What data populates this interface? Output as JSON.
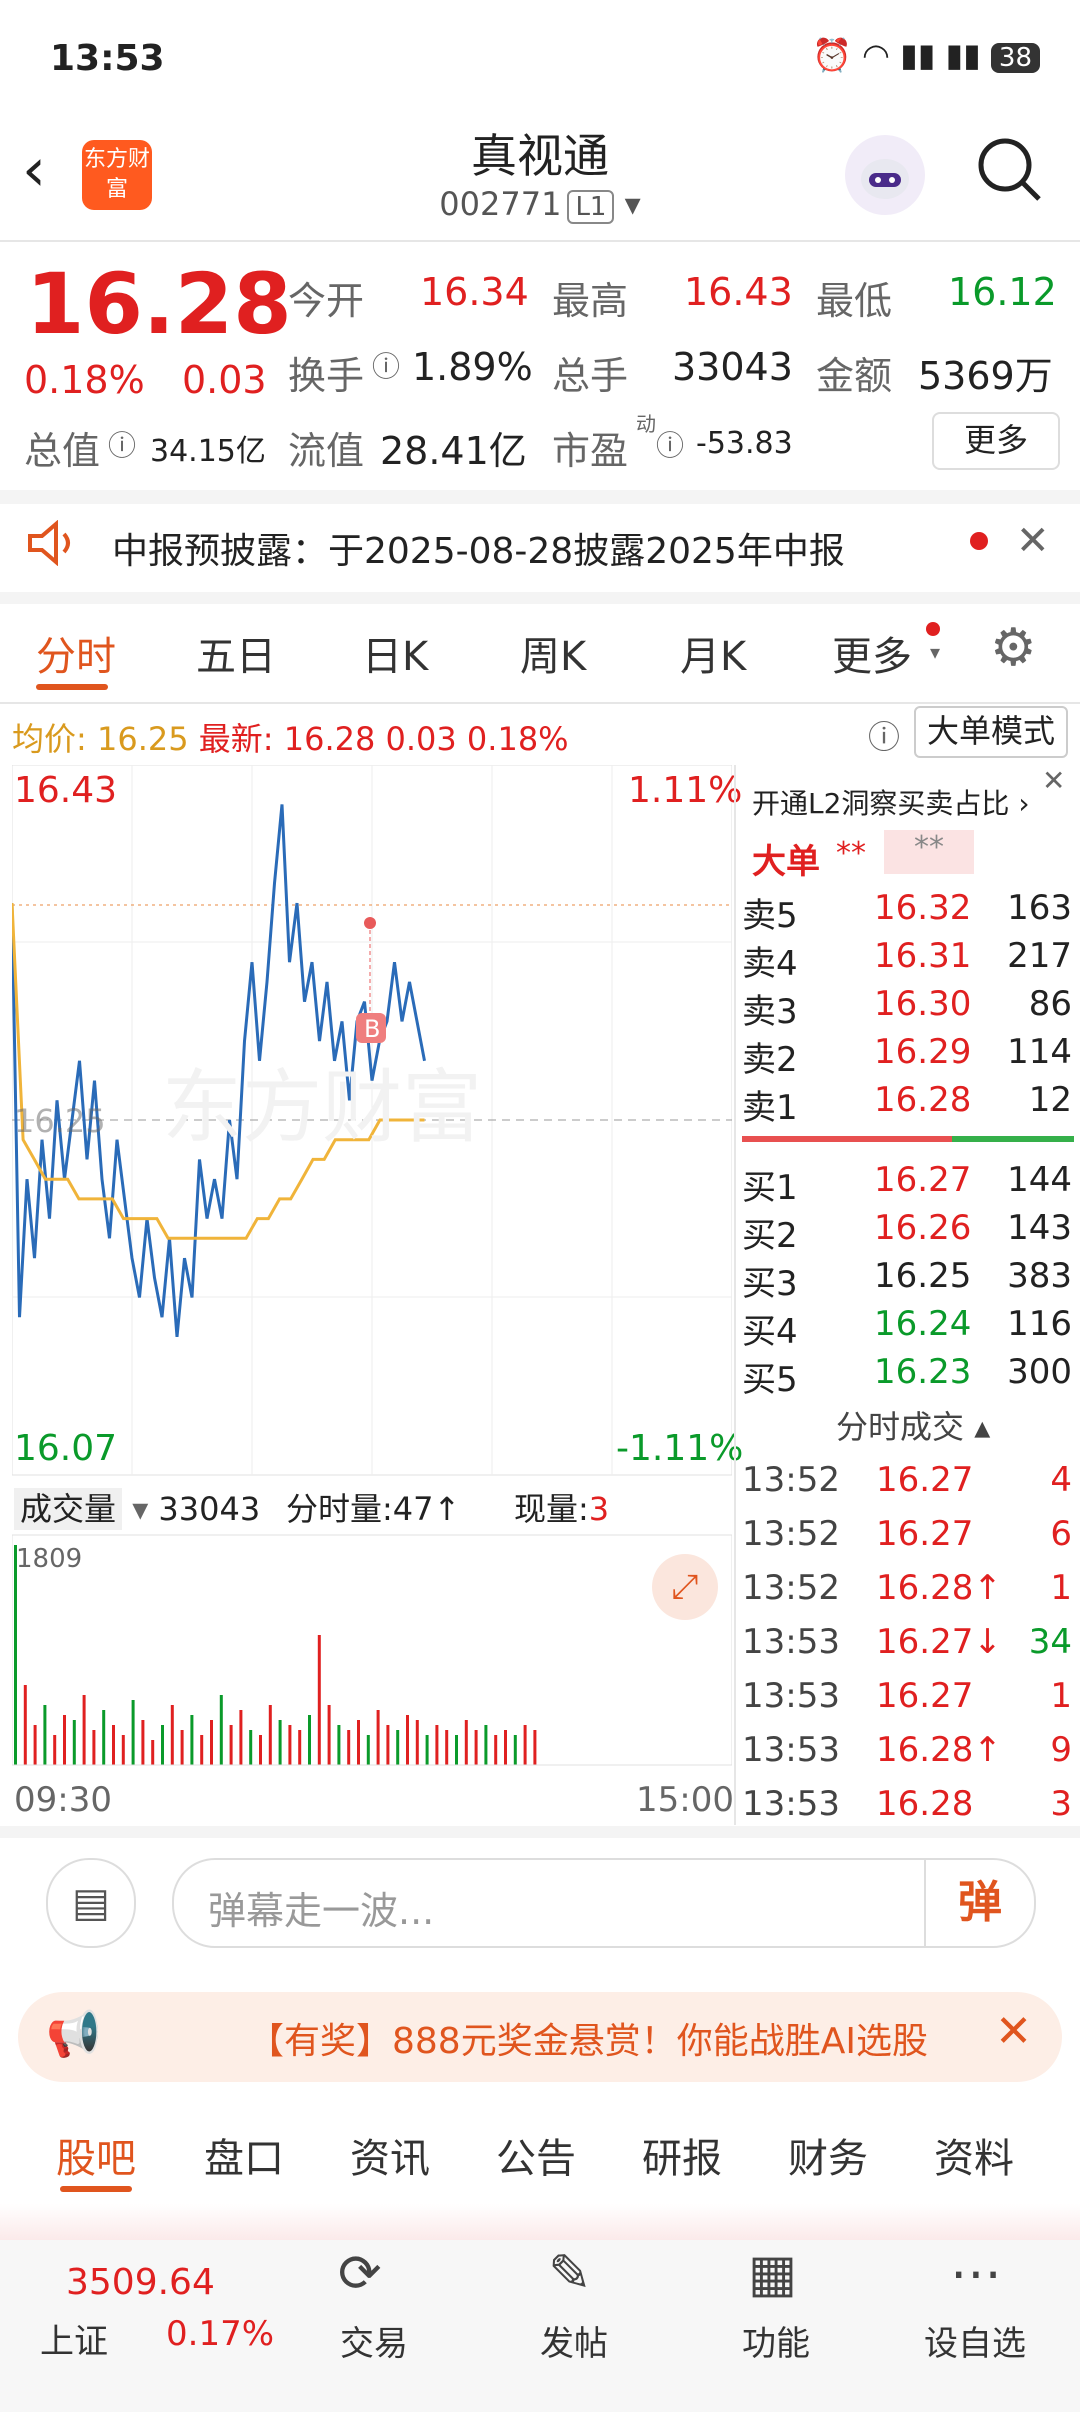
{
  "status": {
    "time": "13:53",
    "battery": "38"
  },
  "header": {
    "title": "真视通",
    "code": "002771",
    "level": "L1",
    "logo_text": "东方财富"
  },
  "quote": {
    "price": "16.28",
    "change_pct": "0.18%",
    "change": "0.03",
    "open_label": "今开",
    "open": "16.34",
    "high_label": "最高",
    "high": "16.43",
    "low_label": "最低",
    "low": "16.12",
    "turnover_label": "换手",
    "turnover": "1.89%",
    "volume_label": "总手",
    "volume": "33043",
    "amount_label": "金额",
    "amount": "5369万",
    "mktcap_label": "总值",
    "mktcap": "34.15亿",
    "float_label": "流值",
    "float_cap": "28.41亿",
    "pe_label": "市盈",
    "pe_sup": "动",
    "pe": "-53.83",
    "more": "更多"
  },
  "notice": {
    "text": "中报预披露：于2025-08-28披露2025年中报"
  },
  "tabs": [
    "分时",
    "五日",
    "日K",
    "周K",
    "月K",
    "更多"
  ],
  "avg_line": {
    "avg_label": "均价:",
    "avg": "16.25",
    "latest_label": "最新:",
    "latest": "16.28",
    "chg": "0.03",
    "pct": "0.18%",
    "mode": "大单模式"
  },
  "chart": {
    "max_price": "16.43",
    "max_pct": "1.11%",
    "min_price": "16.07",
    "min_pct": "-1.11%",
    "prev_close": "16.25",
    "start_time": "09:30",
    "end_time": "15:00",
    "vol_label": "成交量",
    "vol_total": "33043",
    "minute_vol": "分时量:47↑",
    "now_vol_label": "现量:",
    "now_vol": "3",
    "vol_max": "1809",
    "watermark": "东方财富",
    "b_marker": "B"
  },
  "chart_data": {
    "type": "line",
    "x": [
      "09:30",
      "15:00"
    ],
    "ylim": [
      16.07,
      16.43
    ],
    "series": [
      {
        "values": [
          16.36,
          16.15,
          16.22,
          16.18,
          16.24,
          16.2,
          16.26,
          16.22,
          16.25,
          16.28,
          16.23,
          16.27,
          16.22,
          16.19,
          16.24,
          16.21,
          16.18,
          16.16,
          16.2,
          16.17,
          16.15,
          16.19,
          16.14,
          16.18,
          16.16,
          16.23,
          16.2,
          16.22,
          16.2,
          16.25,
          16.22,
          16.29,
          16.33,
          16.28,
          16.32,
          16.37,
          16.41,
          16.33,
          16.36,
          16.31,
          16.33,
          16.29,
          16.32,
          16.28,
          16.3,
          16.26,
          16.3,
          16.31,
          16.27,
          16.29,
          16.3,
          16.33,
          16.3,
          16.32,
          16.3,
          16.28
        ]
      },
      {
        "values": [
          16.36,
          16.24,
          16.23,
          16.22,
          16.22,
          16.22,
          16.21,
          16.21,
          16.21,
          16.21,
          16.2,
          16.2,
          16.2,
          16.2,
          16.19,
          16.19,
          16.19,
          16.19,
          16.19,
          16.19,
          16.19,
          16.19,
          16.2,
          16.2,
          16.21,
          16.21,
          16.22,
          16.23,
          16.23,
          16.24,
          16.24,
          16.24,
          16.24,
          16.25,
          16.25,
          16.25,
          16.25,
          16.25
        ]
      }
    ]
  },
  "orderbook": {
    "l2_text": "开通L2洞察买卖占比",
    "big_label": "大单",
    "big_val1": "**",
    "big_val2": "**",
    "asks": [
      {
        "label": "卖5",
        "price": "16.32",
        "vol": "163"
      },
      {
        "label": "卖4",
        "price": "16.31",
        "vol": "217"
      },
      {
        "label": "卖3",
        "price": "16.30",
        "vol": "86"
      },
      {
        "label": "卖2",
        "price": "16.29",
        "vol": "114"
      },
      {
        "label": "卖1",
        "price": "16.28",
        "vol": "12"
      }
    ],
    "bids": [
      {
        "label": "买1",
        "price": "16.27",
        "vol": "144"
      },
      {
        "label": "买2",
        "price": "16.26",
        "vol": "143"
      },
      {
        "label": "买3",
        "price": "16.25",
        "vol": "383"
      },
      {
        "label": "买4",
        "price": "16.24",
        "vol": "116"
      },
      {
        "label": "买5",
        "price": "16.23",
        "vol": "300"
      }
    ],
    "ticks_title": "分时成交",
    "ticks": [
      {
        "time": "13:52",
        "price": "16.27",
        "vol": "4"
      },
      {
        "time": "13:52",
        "price": "16.27",
        "vol": "6"
      },
      {
        "time": "13:52",
        "price": "16.28↑",
        "vol": "1"
      },
      {
        "time": "13:53",
        "price": "16.27↓",
        "vol": "34"
      },
      {
        "time": "13:53",
        "price": "16.27",
        "vol": "1"
      },
      {
        "time": "13:53",
        "price": "16.28↑",
        "vol": "9"
      },
      {
        "time": "13:53",
        "price": "16.28",
        "vol": "3"
      }
    ]
  },
  "danmu": {
    "placeholder": "弹幕走一波...",
    "btn": "弹"
  },
  "promo": {
    "text": "【有奖】888元奖金悬赏！你能战胜AI选股"
  },
  "bottom_tabs": [
    "股吧",
    "盘口",
    "资讯",
    "公告",
    "研报",
    "财务",
    "资料"
  ],
  "nav": {
    "index_value": "3509.64",
    "index_name": "上证",
    "index_pct": "0.17%",
    "trade": "交易",
    "post": "发帖",
    "func": "功能",
    "watch": "设自选"
  },
  "colors": {
    "up": "#e02020",
    "down": "#0a9a2a",
    "accent": "#e0551e",
    "line": "#2a6bb8",
    "avg": "#f0b43a"
  }
}
